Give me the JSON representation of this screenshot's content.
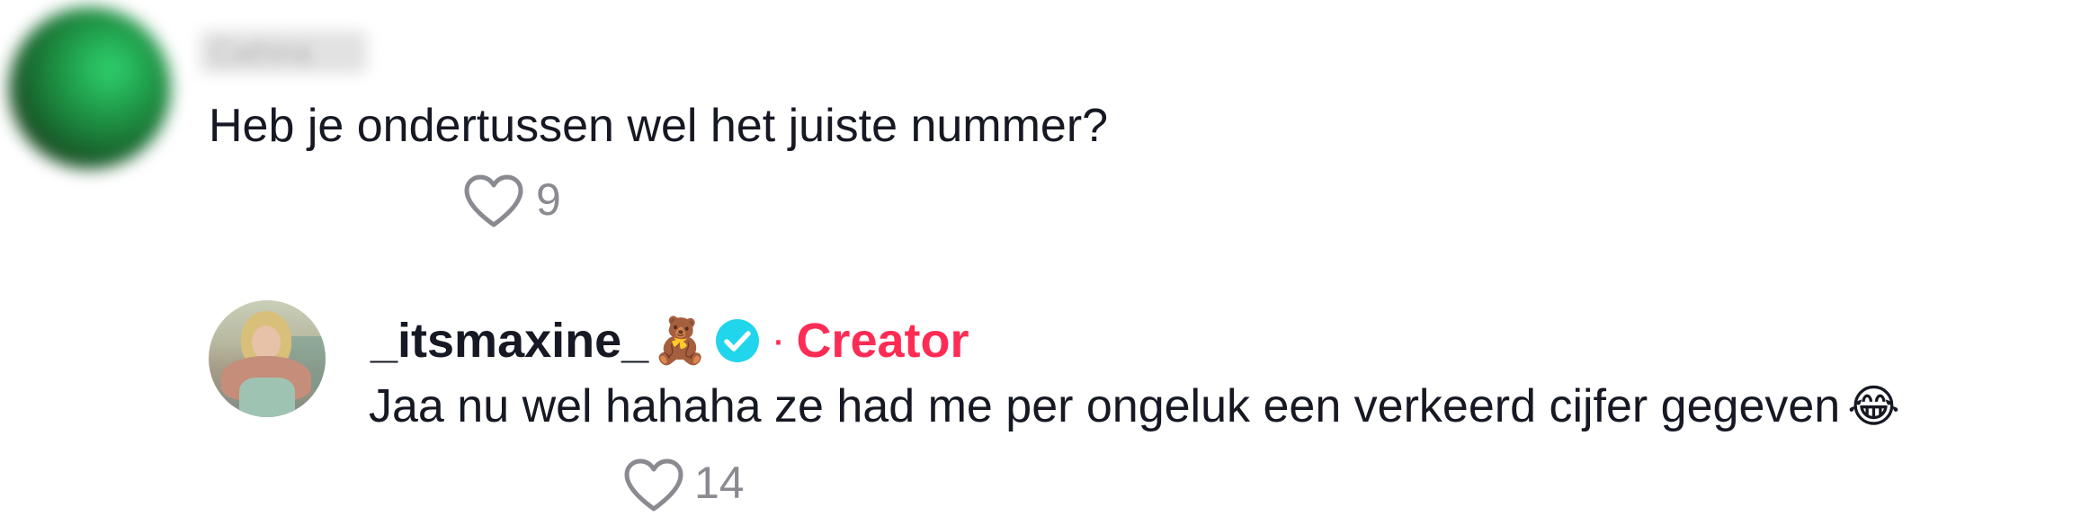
{
  "comments": [
    {
      "username": "Cathina",
      "text": "Heb je ondertussen wel het juiste nummer?",
      "likes": "9"
    }
  ],
  "reply": {
    "username": "_itsmaxine_",
    "username_emoji": "🧸",
    "verified": true,
    "separator": "·",
    "badge": "Creator",
    "text": "Jaa nu wel hahaha ze had me per ongeluk een verkeerd cijfer gegeven",
    "text_emoji": "😂",
    "likes": "14"
  },
  "colors": {
    "text": "#161823",
    "muted": "#8a8b91",
    "creator": "#fe2c55",
    "verified": "#20d5ec"
  },
  "icons": {
    "like": "heart-outline-icon",
    "verified": "verified-check-icon"
  }
}
